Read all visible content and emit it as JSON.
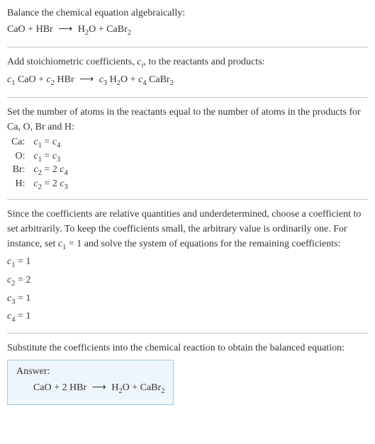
{
  "intro": {
    "line1": "Balance the chemical equation algebraically:",
    "eq_lhs1": "CaO",
    "eq_plus": " + ",
    "eq_lhs2": "HBr",
    "arrow": "⟶",
    "eq_rhs1": "H",
    "eq_rhs1_sub": "2",
    "eq_rhs1b": "O",
    "eq_rhs2": "CaBr",
    "eq_rhs2_sub": "2"
  },
  "step1": {
    "text_a": "Add stoichiometric coefficients, ",
    "ci_c": "c",
    "ci_i": "i",
    "text_b": ", to the reactants and products:",
    "c1": "c",
    "c1n": "1",
    "sp1": " CaO + ",
    "c2": "c",
    "c2n": "2",
    "sp2": " HBr ",
    "arrow": "⟶",
    "c3": "c",
    "c3n": "3",
    "sp3": " H",
    "h2": "2",
    "sp3b": "O + ",
    "c4": "c",
    "c4n": "4",
    "sp4": " CaBr",
    "br2": "2"
  },
  "step2": {
    "text": "Set the number of atoms in the reactants equal to the number of atoms in the products for Ca, O, Br and H:",
    "rows": [
      {
        "el": "Ca:",
        "lhs_c": "c",
        "lhs_n": "1",
        "eq": " = ",
        "rhs_c": "c",
        "rhs_n": "4",
        "rhs_coef": ""
      },
      {
        "el": "O:",
        "lhs_c": "c",
        "lhs_n": "1",
        "eq": " = ",
        "rhs_c": "c",
        "rhs_n": "3",
        "rhs_coef": ""
      },
      {
        "el": "Br:",
        "lhs_c": "c",
        "lhs_n": "2",
        "eq": " = ",
        "rhs_c": "c",
        "rhs_n": "4",
        "rhs_coef": "2 "
      },
      {
        "el": "H:",
        "lhs_c": "c",
        "lhs_n": "2",
        "eq": " = ",
        "rhs_c": "c",
        "rhs_n": "3",
        "rhs_coef": "2 "
      }
    ]
  },
  "step3": {
    "text_a": "Since the coefficients are relative quantities and underdetermined, choose a coefficient to set arbitrarily. To keep the coefficients small, the arbitrary value is ordinarily one. For instance, set ",
    "c": "c",
    "n": "1",
    "text_b": " = 1 and solve the system of equations for the remaining coefficients:",
    "sols": [
      {
        "c": "c",
        "n": "1",
        "eq": " = 1"
      },
      {
        "c": "c",
        "n": "2",
        "eq": " = 2"
      },
      {
        "c": "c",
        "n": "3",
        "eq": " = 1"
      },
      {
        "c": "c",
        "n": "4",
        "eq": " = 1"
      }
    ]
  },
  "step4": {
    "text": "Substitute the coefficients into the chemical reaction to obtain the balanced equation:"
  },
  "answer": {
    "label": "Answer:",
    "lhs1": "CaO + 2 HBr ",
    "arrow": "⟶",
    "rhs_a": " H",
    "rhs_a_sub": "2",
    "rhs_b": "O + CaBr",
    "rhs_b_sub": "2"
  }
}
